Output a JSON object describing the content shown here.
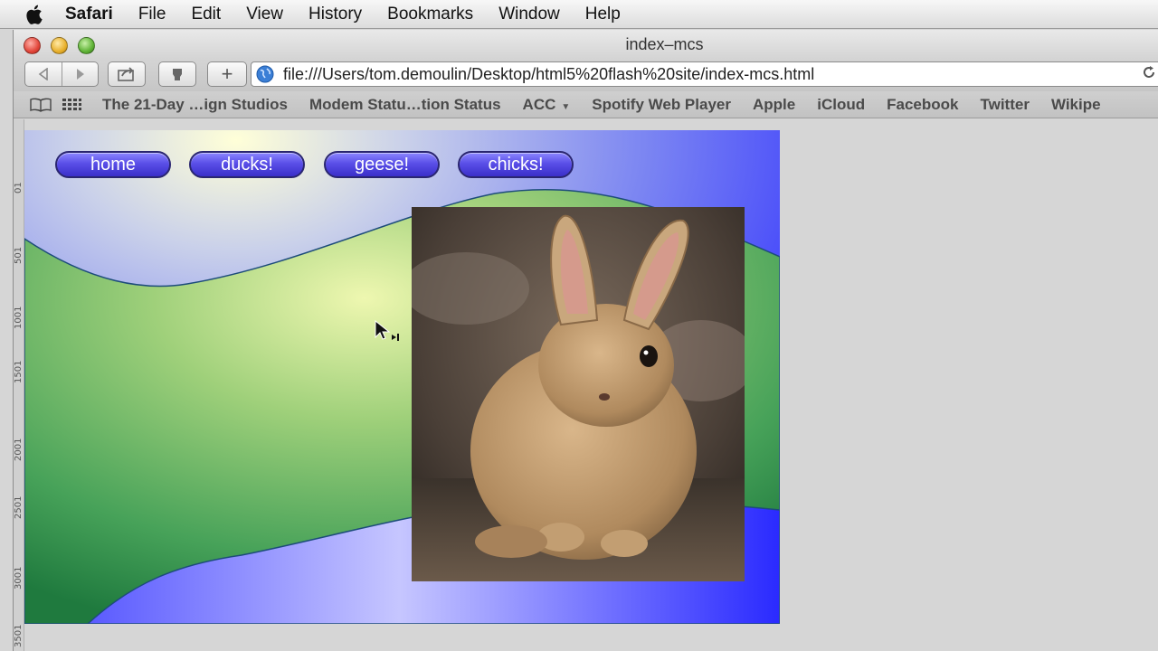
{
  "menubar": {
    "app": "Safari",
    "items": [
      "File",
      "Edit",
      "View",
      "History",
      "Bookmarks",
      "Window",
      "Help"
    ]
  },
  "window": {
    "title": "index–mcs"
  },
  "toolbar": {
    "url": "file:///Users/tom.demoulin/Desktop/html5%20flash%20site/index-mcs.html",
    "add_label": "+"
  },
  "bookmarks": [
    "The 21-Day …ign Studios",
    "Modem Statu…tion Status",
    "ACC",
    "Spotify Web Player",
    "Apple",
    "iCloud",
    "Facebook",
    "Twitter",
    "Wikipe"
  ],
  "site": {
    "nav": [
      "home",
      "ducks!",
      "geese!",
      "chicks!"
    ]
  },
  "ruler_marks": [
    "01",
    "501",
    "1001",
    "1501",
    "2001",
    "2501",
    "3001",
    "3501"
  ],
  "colors": {
    "nav_button": "#5a4fe8",
    "sky_blue": "#3b3bff",
    "hill_green": "#2f8a4a"
  },
  "icons": {
    "apple": "apple-logo-icon",
    "back": "back-arrow-icon",
    "forward": "forward-arrow-icon",
    "share": "share-icon",
    "top_sites": "top-sites-icon",
    "globe": "globe-icon",
    "reload": "reload-icon",
    "reading_list": "book-icon",
    "grid": "grid-icon"
  }
}
